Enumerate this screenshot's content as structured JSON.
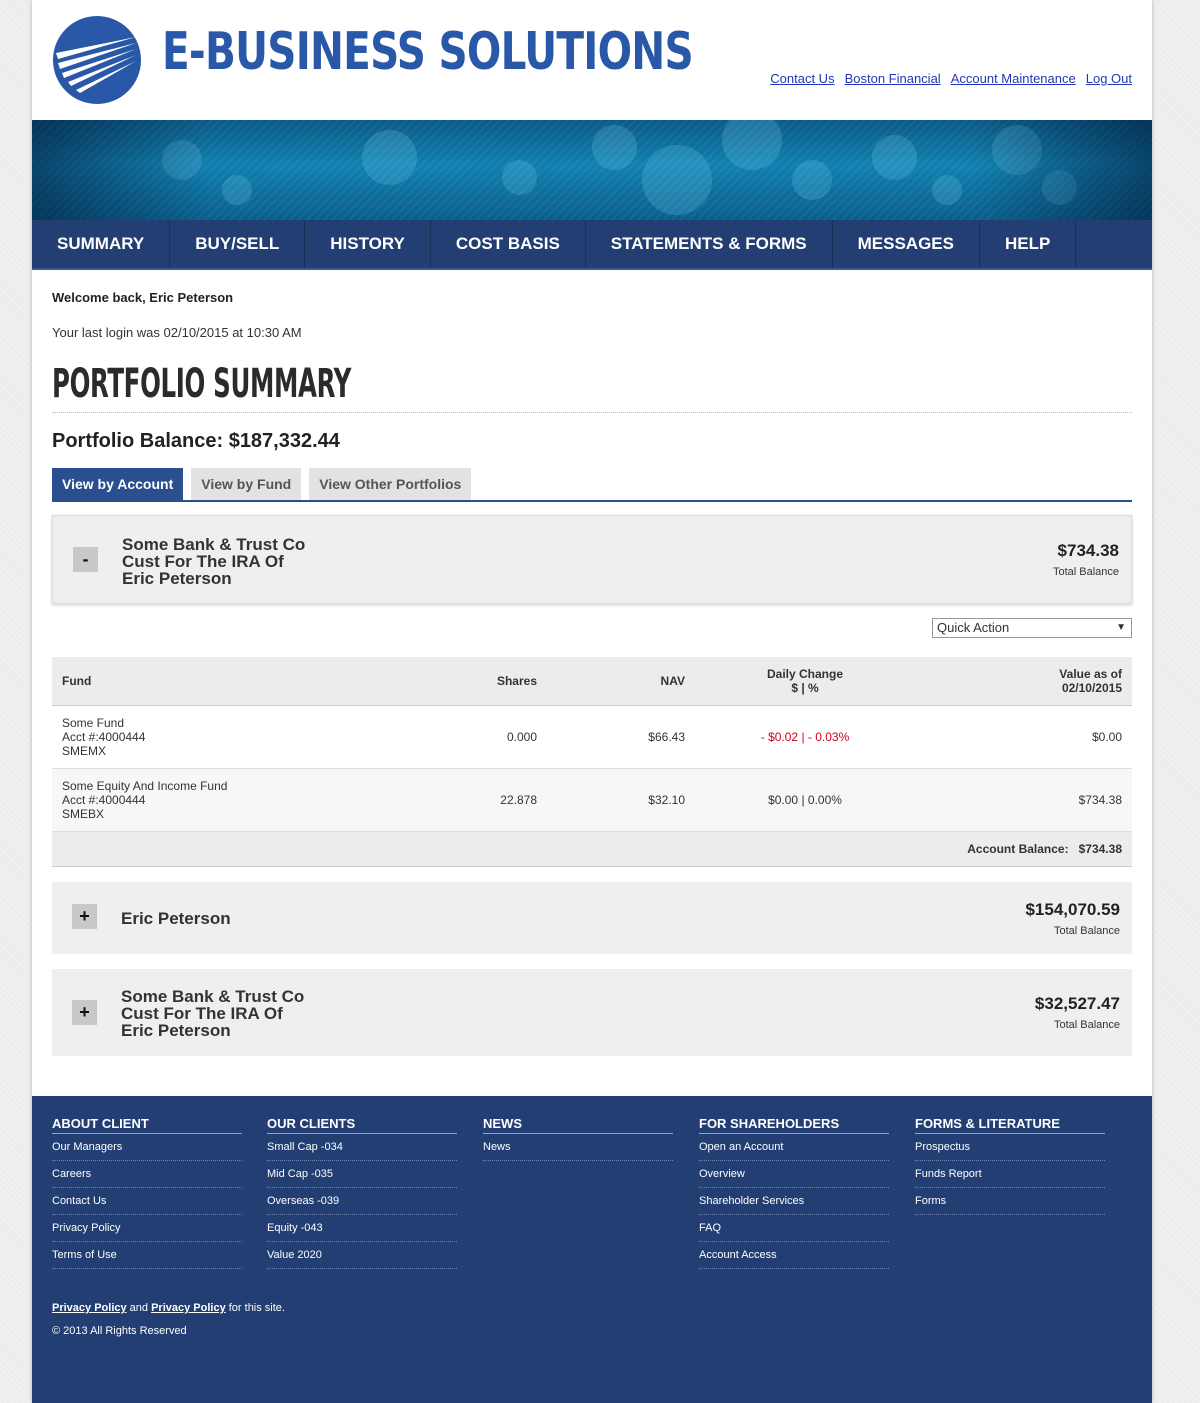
{
  "brand": {
    "name": "E-BUSINESS SOLUTIONS"
  },
  "toplinks": [
    "Contact Us",
    "Boston Financial",
    "Account Maintenance",
    "Log Out"
  ],
  "nav": [
    "SUMMARY",
    "BUY/SELL",
    "HISTORY",
    "COST BASIS",
    "STATEMENTS & FORMS",
    "MESSAGES",
    "HELP"
  ],
  "welcome": "Welcome back, Eric Peterson",
  "last_login": "Your last login was 02/10/2015 at 10:30 AM",
  "page_title": "PORTFOLIO SUMMARY",
  "portfolio_balance": "Portfolio Balance: $187,332.44",
  "tabs": [
    "View by Account",
    "View by Fund",
    "View Other Portfolios"
  ],
  "accounts": [
    {
      "toggle": "-",
      "name_lines": [
        "Some Bank & Trust Co",
        "Cust For The IRA Of",
        "Eric Peterson"
      ],
      "balance": "$734.38",
      "balance_label": "Total Balance"
    },
    {
      "toggle": "+",
      "name_lines": [
        "Eric Peterson"
      ],
      "balance": "$154,070.59",
      "balance_label": "Total Balance"
    },
    {
      "toggle": "+",
      "name_lines": [
        "Some Bank & Trust Co",
        "Cust For The IRA Of",
        "Eric Peterson"
      ],
      "balance": "$32,527.47",
      "balance_label": "Total Balance"
    }
  ],
  "quick_action": {
    "value": "Quick Action",
    "arrow": "▼"
  },
  "table": {
    "headers": {
      "fund": "Fund",
      "shares": "Shares",
      "nav": "NAV",
      "change_1": "Daily Change",
      "change_2": "$ | %",
      "value_1": "Value as of",
      "value_2": "02/10/2015"
    },
    "rows": [
      {
        "name": "Some Fund",
        "acct": "Acct #:4000444",
        "ticker": "SMEMX",
        "shares": "0.000",
        "nav": "$66.43",
        "change": "- $0.02 | - 0.03%",
        "value": "$0.00"
      },
      {
        "name": "Some Equity And Income Fund",
        "acct": "Acct #:4000444",
        "ticker": "SMEBX",
        "shares": "22.878",
        "nav": "$32.10",
        "change": "$0.00 | 0.00%",
        "value": "$734.38"
      }
    ],
    "total_label": "Account Balance:",
    "total_value": "$734.38"
  },
  "footer": {
    "columns": [
      {
        "title": "ABOUT CLIENT",
        "links": [
          "Our Managers",
          "Careers",
          "Contact Us",
          "Privacy Policy",
          "Terms of Use"
        ]
      },
      {
        "title": "OUR CLIENTS",
        "links": [
          "Small Cap -034",
          "Mid Cap -035",
          "Overseas -039",
          "Equity -043",
          "Value 2020"
        ]
      },
      {
        "title": "NEWS",
        "links": [
          "News"
        ]
      },
      {
        "title": "FOR SHAREHOLDERS",
        "links": [
          "Open an Account",
          "Overview",
          "Shareholder Services",
          "FAQ",
          "Account Access"
        ]
      },
      {
        "title": "FORMS & LITERATURE",
        "links": [
          "Prospectus",
          "Funds Report",
          "Forms"
        ]
      }
    ],
    "policy_link_1": "Privacy Policy",
    "and_text": " and ",
    "policy_link_2": "Privacy Policy",
    "for_site": " for this site.",
    "copyright": "© 2013 All Rights Reserved"
  },
  "colors": {
    "navy": "#223e72",
    "accent_blue": "#2a4f8f",
    "link": "#2336b8",
    "negative": "#d0021b"
  }
}
